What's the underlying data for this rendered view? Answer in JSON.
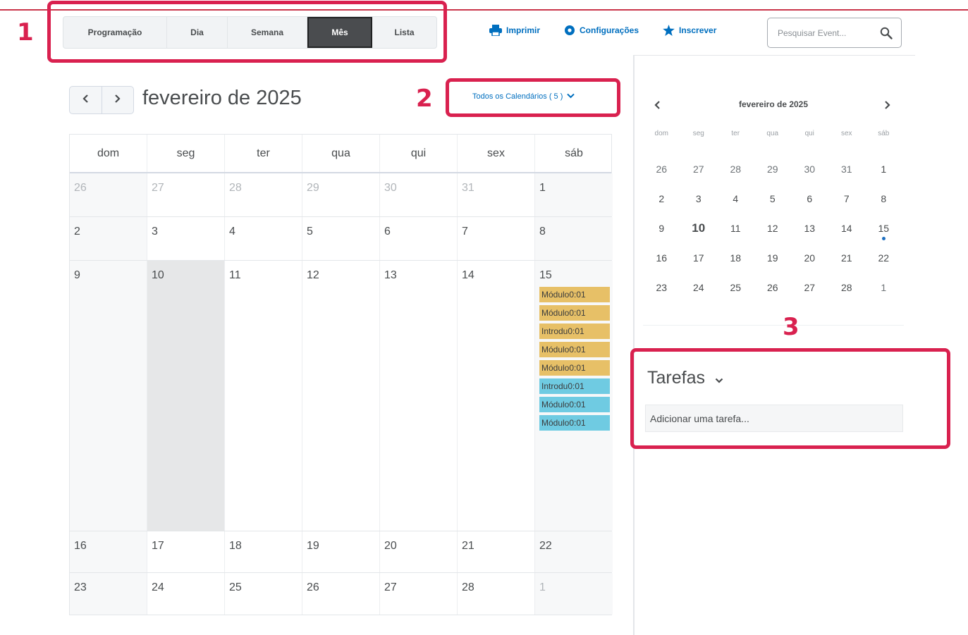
{
  "toolbar": {
    "view_tabs": [
      {
        "label": "Programação",
        "active": false
      },
      {
        "label": "Dia",
        "active": false
      },
      {
        "label": "Semana",
        "active": false
      },
      {
        "label": "Mês",
        "active": true
      },
      {
        "label": "Lista",
        "active": false
      }
    ],
    "actions": [
      {
        "label": "Imprimir",
        "icon": "printer-icon"
      },
      {
        "label": "Configurações",
        "icon": "gear-icon"
      },
      {
        "label": "Inscrever",
        "icon": "star-icon"
      }
    ],
    "search": {
      "placeholder": "Pesquisar Event...",
      "icon": "search-icon"
    }
  },
  "month_view": {
    "title": "fevereiro de 2025",
    "calendar_filter": "Todos os Calendários ( 5 )",
    "weekdays": [
      "dom",
      "seg",
      "ter",
      "qua",
      "qui",
      "sex",
      "sáb"
    ],
    "weeks": [
      {
        "days": [
          {
            "n": "26",
            "other": true
          },
          {
            "n": "27",
            "other": true
          },
          {
            "n": "28",
            "other": true
          },
          {
            "n": "29",
            "other": true
          },
          {
            "n": "30",
            "other": true
          },
          {
            "n": "31",
            "other": true
          },
          {
            "n": "1",
            "other": false
          }
        ]
      },
      {
        "days": [
          {
            "n": "2"
          },
          {
            "n": "3"
          },
          {
            "n": "4"
          },
          {
            "n": "5"
          },
          {
            "n": "6"
          },
          {
            "n": "7"
          },
          {
            "n": "8"
          }
        ]
      },
      {
        "days": [
          {
            "n": "9"
          },
          {
            "n": "10",
            "today": true
          },
          {
            "n": "11"
          },
          {
            "n": "12"
          },
          {
            "n": "13"
          },
          {
            "n": "14"
          },
          {
            "n": "15",
            "events": [
              {
                "label": "Módulo0:01",
                "color": "#e7c067"
              },
              {
                "label": "Módulo0:01",
                "color": "#e7c067"
              },
              {
                "label": "Introdu0:01",
                "color": "#e7c067"
              },
              {
                "label": "Módulo0:01",
                "color": "#e7c067"
              },
              {
                "label": "Módulo0:01",
                "color": "#e7c067"
              },
              {
                "label": "Introdu0:01",
                "color": "#6fcbe2"
              },
              {
                "label": "Módulo0:01",
                "color": "#6fcbe2"
              },
              {
                "label": "Módulo0:01",
                "color": "#6fcbe2"
              }
            ]
          }
        ]
      },
      {
        "days": [
          {
            "n": "16"
          },
          {
            "n": "17"
          },
          {
            "n": "18"
          },
          {
            "n": "19"
          },
          {
            "n": "20"
          },
          {
            "n": "21"
          },
          {
            "n": "22"
          }
        ]
      },
      {
        "days": [
          {
            "n": "23"
          },
          {
            "n": "24"
          },
          {
            "n": "25"
          },
          {
            "n": "26"
          },
          {
            "n": "27"
          },
          {
            "n": "28"
          },
          {
            "n": "1",
            "other": true
          }
        ]
      }
    ]
  },
  "mini_calendar": {
    "title": "fevereiro de 2025",
    "weekdays": [
      "dom",
      "seg",
      "ter",
      "qua",
      "qui",
      "sex",
      "sáb"
    ],
    "days": [
      {
        "n": "26",
        "dim": true
      },
      {
        "n": "27",
        "dim": true
      },
      {
        "n": "28",
        "dim": true
      },
      {
        "n": "29",
        "dim": true
      },
      {
        "n": "30",
        "dim": true
      },
      {
        "n": "31",
        "dim": true
      },
      {
        "n": "1"
      },
      {
        "n": "2"
      },
      {
        "n": "3"
      },
      {
        "n": "4"
      },
      {
        "n": "5"
      },
      {
        "n": "6"
      },
      {
        "n": "7"
      },
      {
        "n": "8"
      },
      {
        "n": "9"
      },
      {
        "n": "10",
        "today": true
      },
      {
        "n": "11"
      },
      {
        "n": "12"
      },
      {
        "n": "13"
      },
      {
        "n": "14"
      },
      {
        "n": "15",
        "has_event": true
      },
      {
        "n": "16"
      },
      {
        "n": "17"
      },
      {
        "n": "18"
      },
      {
        "n": "19"
      },
      {
        "n": "20"
      },
      {
        "n": "21"
      },
      {
        "n": "22"
      },
      {
        "n": "23"
      },
      {
        "n": "24"
      },
      {
        "n": "25"
      },
      {
        "n": "26"
      },
      {
        "n": "27"
      },
      {
        "n": "28"
      },
      {
        "n": "1",
        "dim": true
      }
    ]
  },
  "tasks": {
    "title": "Tarefas",
    "input_placeholder": "Adicionar uma tarefa..."
  },
  "annotations": [
    {
      "number": "1"
    },
    {
      "number": "2"
    },
    {
      "number": "3"
    }
  ],
  "colors": {
    "accent_link": "#006fbf",
    "callout": "#d9214f",
    "event_gold": "#e7c067",
    "event_teal": "#6fcbe2",
    "active_tab": "#4a4c4f"
  }
}
